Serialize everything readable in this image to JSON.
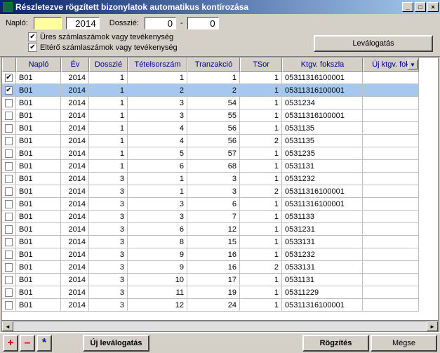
{
  "window": {
    "title": "Részletezve rögzített bizonylatok automatikus kontírozása",
    "min": "_",
    "max": "□",
    "close": "×"
  },
  "filters": {
    "naplo_label": "Napló:",
    "naplo_value": "",
    "ev_value": "2014",
    "dosszie_label": "Dosszié:",
    "dosszie_from": "0",
    "dash": "-",
    "dosszie_to": "0"
  },
  "checkboxes": {
    "empty_label": "Üres számlaszámok vagy tevékenység",
    "diff_label": "Eltérő számlaszámok vagy tevékenység"
  },
  "buttons": {
    "levalogatas": "Leválogatás",
    "uj_levalogatas": "Új leválogatás",
    "rogzites": "Rögzítés",
    "megse": "Mégse",
    "plus": "+",
    "minus": "–",
    "star": "*"
  },
  "columns": {
    "naplo": "Napló",
    "ev": "Év",
    "dosszie": "Dosszié",
    "tetel": "Tételsorszám",
    "tranz": "Tranzakció",
    "tsor": "TSor",
    "ktgv": "Ktgv. fokszla",
    "ujktgv": "Új ktgv. fok"
  },
  "rows": [
    {
      "chk": true,
      "sel": false,
      "naplo": "B01",
      "ev": "2014",
      "dosszie": "1",
      "tetel": "1",
      "tranz": "1",
      "tsor": "1",
      "ktgv": "05311316100001"
    },
    {
      "chk": true,
      "sel": true,
      "naplo": "B01",
      "ev": "2014",
      "dosszie": "1",
      "tetel": "2",
      "tranz": "2",
      "tsor": "1",
      "ktgv": "05311316100001"
    },
    {
      "chk": false,
      "sel": false,
      "naplo": "B01",
      "ev": "2014",
      "dosszie": "1",
      "tetel": "3",
      "tranz": "54",
      "tsor": "1",
      "ktgv": "0531234"
    },
    {
      "chk": false,
      "sel": false,
      "naplo": "B01",
      "ev": "2014",
      "dosszie": "1",
      "tetel": "3",
      "tranz": "55",
      "tsor": "1",
      "ktgv": "05311316100001"
    },
    {
      "chk": false,
      "sel": false,
      "naplo": "B01",
      "ev": "2014",
      "dosszie": "1",
      "tetel": "4",
      "tranz": "56",
      "tsor": "1",
      "ktgv": "0531135"
    },
    {
      "chk": false,
      "sel": false,
      "naplo": "B01",
      "ev": "2014",
      "dosszie": "1",
      "tetel": "4",
      "tranz": "56",
      "tsor": "2",
      "ktgv": "0531135"
    },
    {
      "chk": false,
      "sel": false,
      "naplo": "B01",
      "ev": "2014",
      "dosszie": "1",
      "tetel": "5",
      "tranz": "57",
      "tsor": "1",
      "ktgv": "0531235"
    },
    {
      "chk": false,
      "sel": false,
      "naplo": "B01",
      "ev": "2014",
      "dosszie": "1",
      "tetel": "6",
      "tranz": "68",
      "tsor": "1",
      "ktgv": "0531131"
    },
    {
      "chk": false,
      "sel": false,
      "naplo": "B01",
      "ev": "2014",
      "dosszie": "3",
      "tetel": "1",
      "tranz": "3",
      "tsor": "1",
      "ktgv": "0531232"
    },
    {
      "chk": false,
      "sel": false,
      "naplo": "B01",
      "ev": "2014",
      "dosszie": "3",
      "tetel": "1",
      "tranz": "3",
      "tsor": "2",
      "ktgv": "05311316100001"
    },
    {
      "chk": false,
      "sel": false,
      "naplo": "B01",
      "ev": "2014",
      "dosszie": "3",
      "tetel": "3",
      "tranz": "6",
      "tsor": "1",
      "ktgv": "05311316100001"
    },
    {
      "chk": false,
      "sel": false,
      "naplo": "B01",
      "ev": "2014",
      "dosszie": "3",
      "tetel": "3",
      "tranz": "7",
      "tsor": "1",
      "ktgv": "0531133"
    },
    {
      "chk": false,
      "sel": false,
      "naplo": "B01",
      "ev": "2014",
      "dosszie": "3",
      "tetel": "6",
      "tranz": "12",
      "tsor": "1",
      "ktgv": "0531231"
    },
    {
      "chk": false,
      "sel": false,
      "naplo": "B01",
      "ev": "2014",
      "dosszie": "3",
      "tetel": "8",
      "tranz": "15",
      "tsor": "1",
      "ktgv": "0533131"
    },
    {
      "chk": false,
      "sel": false,
      "naplo": "B01",
      "ev": "2014",
      "dosszie": "3",
      "tetel": "9",
      "tranz": "16",
      "tsor": "1",
      "ktgv": "0531232"
    },
    {
      "chk": false,
      "sel": false,
      "naplo": "B01",
      "ev": "2014",
      "dosszie": "3",
      "tetel": "9",
      "tranz": "16",
      "tsor": "2",
      "ktgv": "0533131"
    },
    {
      "chk": false,
      "sel": false,
      "naplo": "B01",
      "ev": "2014",
      "dosszie": "3",
      "tetel": "10",
      "tranz": "17",
      "tsor": "1",
      "ktgv": "0531131"
    },
    {
      "chk": false,
      "sel": false,
      "naplo": "B01",
      "ev": "2014",
      "dosszie": "3",
      "tetel": "11",
      "tranz": "19",
      "tsor": "1",
      "ktgv": "05311229"
    },
    {
      "chk": false,
      "sel": false,
      "naplo": "B01",
      "ev": "2014",
      "dosszie": "3",
      "tetel": "12",
      "tranz": "24",
      "tsor": "1",
      "ktgv": "05311316100001"
    }
  ]
}
